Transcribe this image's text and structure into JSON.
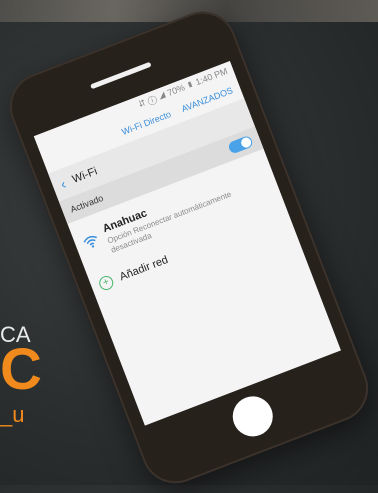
{
  "status": {
    "text": "⮃ ⓘ ◢ 70% ▮ 1:40 PM"
  },
  "top_actions": {
    "wifi_direct": "Wi-Fi Directo",
    "advanced": "AVANZADOS"
  },
  "toolbar": {
    "back_icon": "‹",
    "title": "Wi-Fi"
  },
  "toggle": {
    "label": "Activado",
    "state": "on"
  },
  "network": {
    "name": "Anahuac",
    "description": "Opción Reconectar automáticamente desactivada",
    "icon": "wifi-icon"
  },
  "add_network": {
    "label": "Añadir red",
    "icon": "plus-icon"
  },
  "side_text": {
    "line1": "CA",
    "line2": "C",
    "line3": "_u"
  },
  "colors": {
    "accent": "#3a8edb",
    "toggle_on": "#4aa3e8",
    "brand_orange": "#f08a1c",
    "phone_body": "#27211c"
  }
}
